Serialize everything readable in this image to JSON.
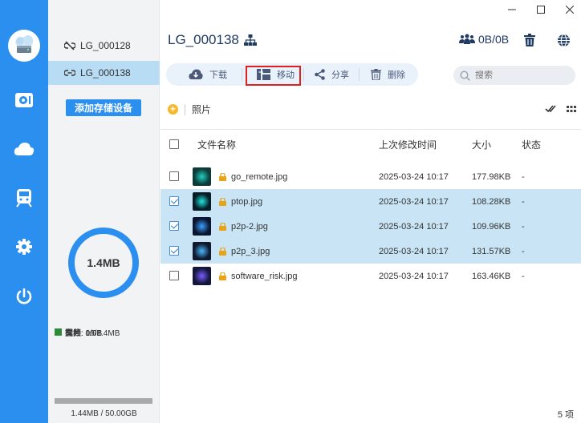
{
  "devices": [
    {
      "name": "LG_000128",
      "active": false
    },
    {
      "name": "LG_000138",
      "active": true
    }
  ],
  "add_device_label": "添加存储设备",
  "storage": {
    "used_label": "1.4MB",
    "legend": [
      {
        "label": "视频: 0/0B",
        "color": "#f06014"
      },
      {
        "label": "图片: 10/1.4MB",
        "color": "#2b7dd8"
      },
      {
        "label": "音频: 0/0B",
        "color": "#f8b82c"
      },
      {
        "label": "文档: 0/0B",
        "color": "#2e8b3a"
      }
    ],
    "capacity_text": "1.44MB / 50.00GB",
    "used_fraction": 3e-05,
    "ring_color": "#2b8ff0"
  },
  "header": {
    "title": "LG_000138",
    "speed": "0B/0B",
    "icons": [
      "network-icon",
      "users-icon",
      "trash-icon",
      "globe-icon"
    ]
  },
  "toolbar": {
    "download": "下载",
    "move": "移动",
    "share": "分享",
    "delete": "删除"
  },
  "search": {
    "placeholder": "搜索"
  },
  "breadcrumb": {
    "folder": "照片"
  },
  "table": {
    "columns": {
      "name": "文件名称",
      "modified": "上次修改时间",
      "size": "大小",
      "status": "状态"
    },
    "rows": [
      {
        "name": "go_remote.jpg",
        "modified": "2025-03-24 10:17",
        "size": "177.98KB",
        "status": "-",
        "selected": false
      },
      {
        "name": "ptop.jpg",
        "modified": "2025-03-24 10:17",
        "size": "108.28KB",
        "status": "-",
        "selected": true
      },
      {
        "name": "p2p-2.jpg",
        "modified": "2025-03-24 10:17",
        "size": "109.96KB",
        "status": "-",
        "selected": true
      },
      {
        "name": "p2p_3.jpg",
        "modified": "2025-03-24 10:17",
        "size": "131.57KB",
        "status": "-",
        "selected": true
      },
      {
        "name": "software_risk.jpg",
        "modified": "2025-03-24 10:17",
        "size": "163.46KB",
        "status": "-",
        "selected": false
      }
    ]
  },
  "footer": {
    "count": "5 项"
  },
  "colors": {
    "accent": "#2b8ff0",
    "selected_row": "#c9e5f5",
    "highlight_box": "#e02020"
  }
}
